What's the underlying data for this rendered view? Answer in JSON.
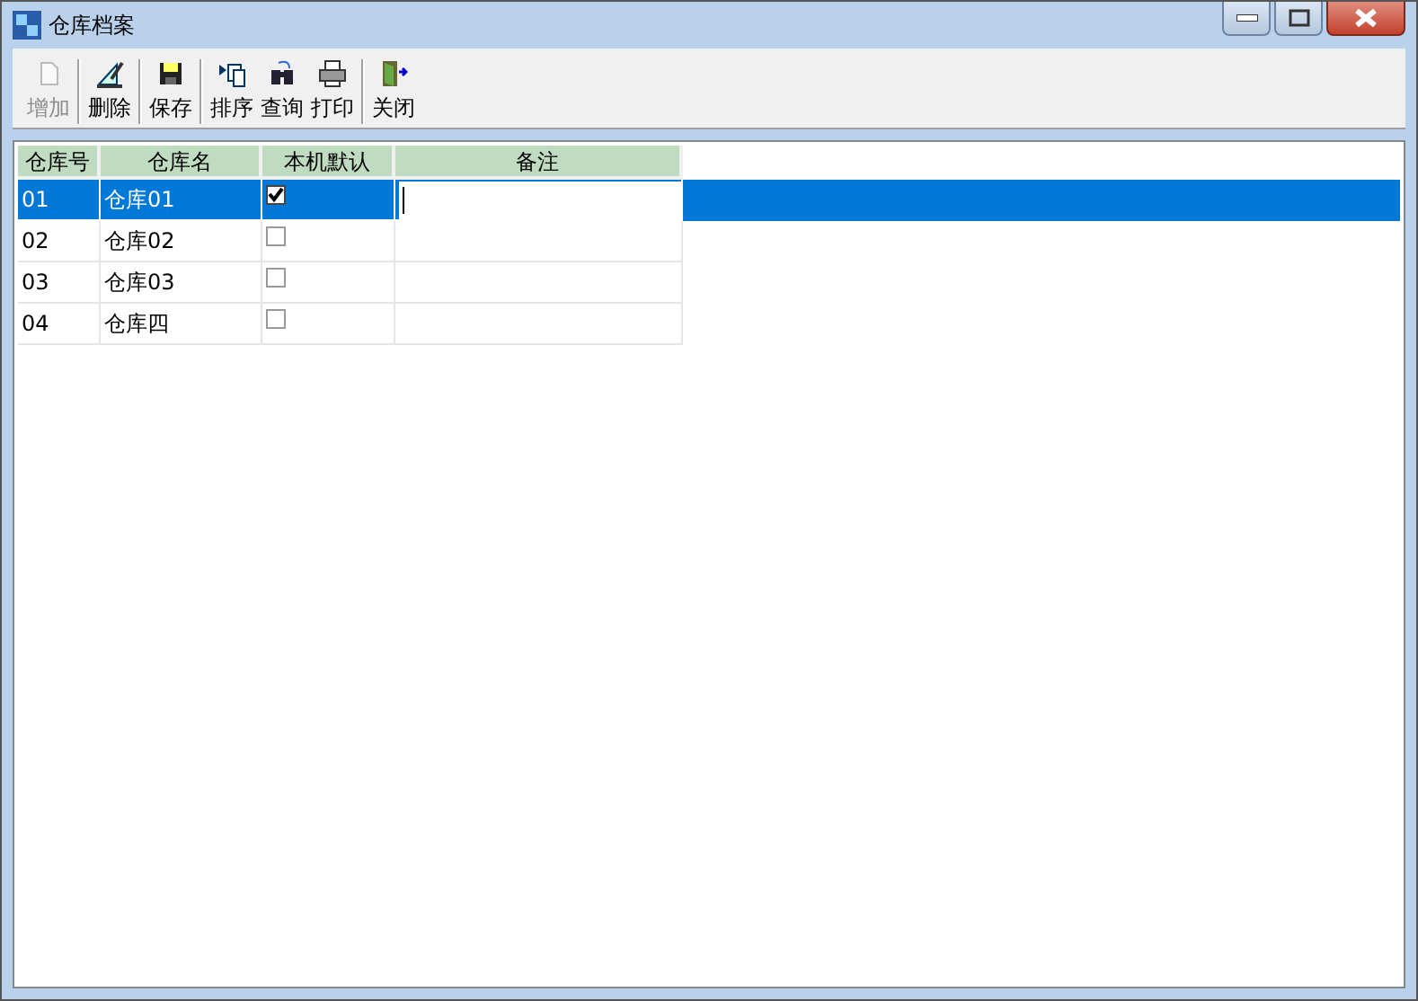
{
  "window": {
    "title": "仓库档案"
  },
  "toolbar": [
    {
      "kind": "add",
      "label": "增加",
      "disabled": true,
      "separator_after": true
    },
    {
      "kind": "delete",
      "label": "删除",
      "disabled": false,
      "separator_after": true
    },
    {
      "kind": "save",
      "label": "保存",
      "disabled": false,
      "separator_after": true
    },
    {
      "kind": "sort",
      "label": "排序",
      "disabled": false,
      "separator_after": false
    },
    {
      "kind": "search",
      "label": "查询",
      "disabled": false,
      "separator_after": false
    },
    {
      "kind": "print",
      "label": "打印",
      "disabled": false,
      "separator_after": true
    },
    {
      "kind": "close",
      "label": "关闭",
      "disabled": false,
      "separator_after": false
    }
  ],
  "table": {
    "columns": [
      "仓库号",
      "仓库名",
      "本机默认",
      "备注"
    ],
    "rows": [
      {
        "number": "01",
        "name": "仓库01",
        "default": true,
        "selected": true
      },
      {
        "number": "02",
        "name": "仓库02",
        "default": false,
        "selected": false
      },
      {
        "number": "03",
        "name": "仓库03",
        "default": false,
        "selected": false
      },
      {
        "number": "04",
        "name": "仓库四",
        "default": false,
        "selected": false
      }
    ]
  }
}
